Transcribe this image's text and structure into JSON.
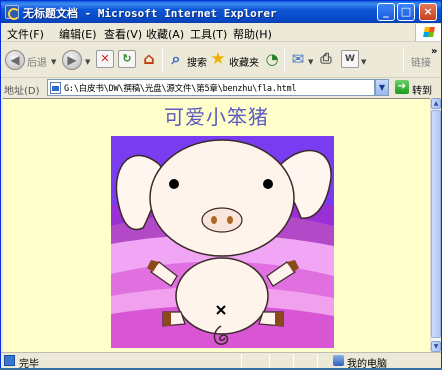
{
  "window": {
    "title": "无标题文档 - Microsoft Internet Explorer"
  },
  "menu": {
    "items": [
      {
        "label": "文件(F)"
      },
      {
        "label": "编辑(E)"
      },
      {
        "label": "查看(V)"
      },
      {
        "label": "收藏(A)"
      },
      {
        "label": "工具(T)"
      },
      {
        "label": "帮助(H)"
      }
    ]
  },
  "toolbar": {
    "back_label": "后退",
    "search_label": "搜索",
    "favorites_label": "收藏夹",
    "links_label": "链接"
  },
  "address": {
    "label": "地址(D)",
    "url": "G:\\白皮书\\DW\\撰稿\\光盘\\源文件\\第5章\\benzhu\\fla.html",
    "go_label": "转到"
  },
  "page": {
    "heading": "可爱小笨猪"
  },
  "status": {
    "text": "完毕",
    "zone": "我的电脑"
  },
  "colors": {
    "heading": "#5b5bc0",
    "page_background": "#ffffcc",
    "titlebar": "#0a5fd8"
  }
}
